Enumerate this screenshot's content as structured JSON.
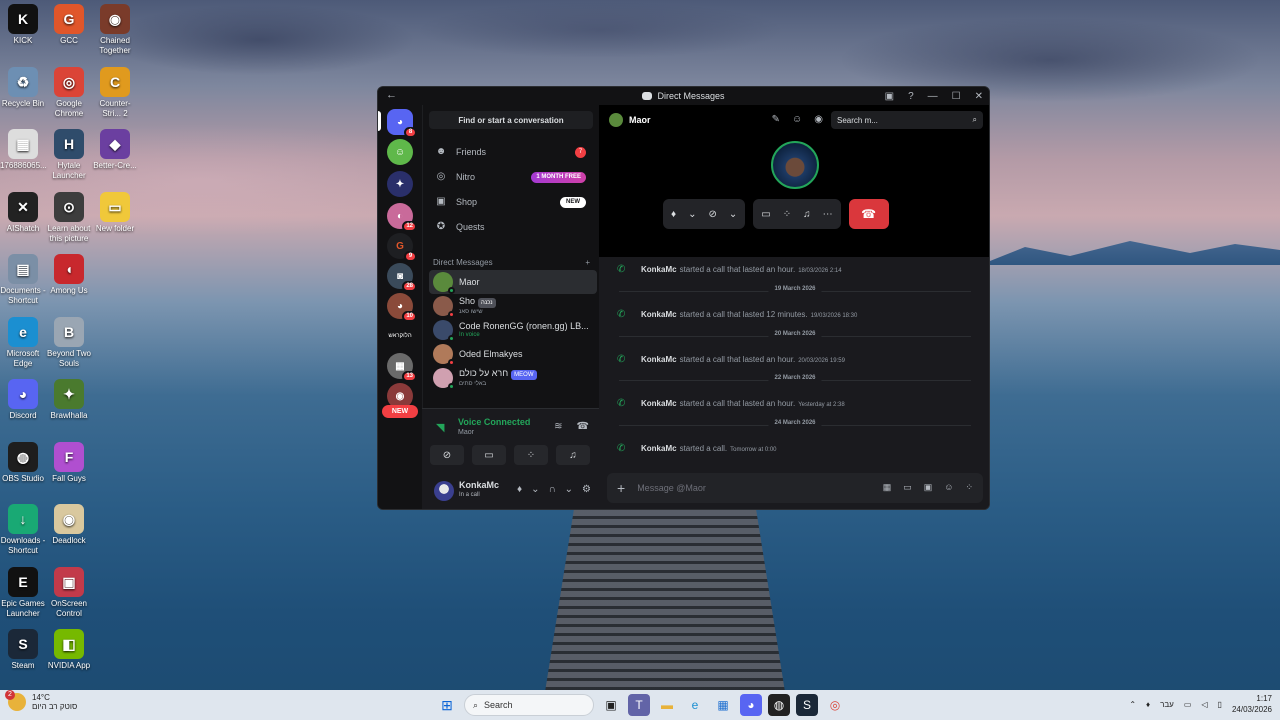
{
  "desktop": {
    "icons": [
      {
        "label": "KICK",
        "color": "#111111",
        "glyph": "K"
      },
      {
        "label": "GCC",
        "color": "#e0562a",
        "glyph": "G"
      },
      {
        "label": "Chained Together",
        "color": "#7a3b2a",
        "glyph": "◉"
      },
      {
        "label": "Recycle Bin",
        "color": "#6d8fb3",
        "glyph": "♻"
      },
      {
        "label": "Google Chrome",
        "color": "#db4437",
        "glyph": "◎"
      },
      {
        "label": "Counter-Stri... 2",
        "color": "#e09a1e",
        "glyph": "C"
      },
      {
        "label": "176886065...",
        "color": "#dddddd",
        "glyph": "▦"
      },
      {
        "label": "Hytale Launcher",
        "color": "#2f4c6b",
        "glyph": "H"
      },
      {
        "label": "Better-Cre...",
        "color": "#6b3fa0",
        "glyph": "◆"
      },
      {
        "label": "AIShatch",
        "color": "#222222",
        "glyph": "✕"
      },
      {
        "label": "Learn about this picture",
        "color": "#3d3d3d",
        "glyph": "⊙"
      },
      {
        "label": "New folder",
        "color": "#f0c83a",
        "glyph": "▭"
      },
      {
        "label": "Documents - Shortcut",
        "color": "#7b8fa6",
        "glyph": "▤"
      },
      {
        "label": "Among Us",
        "color": "#c8282d",
        "glyph": "◖"
      },
      {
        "label": "Microsoft Edge",
        "color": "#1b8fd1",
        "glyph": "e"
      },
      {
        "label": "Beyond Two Souls",
        "color": "#9aa6b3",
        "glyph": "B"
      },
      {
        "label": "Discord",
        "color": "#5865f2",
        "glyph": "◕"
      },
      {
        "label": "Brawlhalla",
        "color": "#4a7a2e",
        "glyph": "✦"
      },
      {
        "label": "OBS Studio",
        "color": "#1e1e1e",
        "glyph": "◍"
      },
      {
        "label": "Fall Guys",
        "color": "#b04fd0",
        "glyph": "F"
      },
      {
        "label": "Downloads - Shortcut",
        "color": "#19a974",
        "glyph": "↓"
      },
      {
        "label": "Deadlock",
        "color": "#d9c89e",
        "glyph": "◉"
      },
      {
        "label": "Epic Games Launcher",
        "color": "#111111",
        "glyph": "E"
      },
      {
        "label": "OnScreen Control",
        "color": "#c23a4a",
        "glyph": "▣"
      },
      {
        "label": "Steam",
        "color": "#1b2838",
        "glyph": "S"
      },
      {
        "label": "NVIDIA App",
        "color": "#76b900",
        "glyph": "◧"
      }
    ]
  },
  "taskbar": {
    "weather_temp": "14°C",
    "weather_desc": "סוטק רב היום",
    "weather_badge": "2",
    "search_label": "Search",
    "lang": "עבר",
    "time": "1:17",
    "date": "24/03/2026"
  },
  "window": {
    "title": "Direct Messages",
    "back": "←",
    "help": "?",
    "minimize": "—",
    "maximize": "☐",
    "close": "✕"
  },
  "servers": {
    "badges": [
      "8",
      "",
      "",
      "12",
      "9",
      "28",
      "10",
      "",
      "13"
    ],
    "new_label": "NEW",
    "text_server": "הלוקראש"
  },
  "dm_nav": {
    "find_label": "Find or start a conversation",
    "items": [
      {
        "label": "Friends",
        "icon": "friends-icon",
        "glyph": "☻"
      },
      {
        "label": "Nitro",
        "icon": "nitro-icon",
        "glyph": "◎"
      },
      {
        "label": "Shop",
        "icon": "shop-icon",
        "glyph": "▣"
      },
      {
        "label": "Quests",
        "icon": "quests-icon",
        "glyph": "✪"
      }
    ],
    "friends_count": "7",
    "nitro_badge": "1 MONTH FREE",
    "shop_badge": "NEW",
    "dm_header": "Direct Messages",
    "add": "+"
  },
  "dms": [
    {
      "name": "Maor",
      "sub": "",
      "color": "#5a8a3c",
      "status": "#23a55a",
      "active": true
    },
    {
      "name": "Sho",
      "tag": "נכנה",
      "sub": "שישו סאנ",
      "color": "#8a5a4a",
      "status": "#f23f43",
      "active": false
    },
    {
      "name": "Code RonenGG (ronen.gg) LB...",
      "sub": "In voice",
      "color": "#3a4a6a",
      "status": "#23a55a",
      "active": false
    },
    {
      "name": "Oded Elmakyes",
      "sub": "",
      "color": "#b07a5a",
      "status": "#f23f43",
      "active": false
    },
    {
      "name": "חרא על כולם",
      "tag": "MEOW",
      "sub": "באלי סתים",
      "color": "#d0a0b0",
      "status": "#23a55a",
      "active": false
    }
  ],
  "voice": {
    "title": "Voice Connected",
    "channel": "Maor"
  },
  "user": {
    "name": "KonkaMc",
    "status": "In a call"
  },
  "chat": {
    "recipient": "Maor",
    "search_placeholder": "Search m...",
    "composer_placeholder": "Message @Maor",
    "messages": [
      {
        "author": "KonkaMc",
        "text": "started a call that lasted an hour.",
        "time": "18/03/2026 2:14"
      },
      {
        "author": "KonkaMc",
        "text": "started a call that lasted 12 minutes.",
        "time": "19/03/2026 18:30"
      },
      {
        "author": "KonkaMc",
        "text": "started a call that lasted an hour.",
        "time": "20/03/2026 19:59"
      },
      {
        "author": "KonkaMc",
        "text": "started a call that lasted an hour.",
        "time": "Yesterday at 2:38"
      },
      {
        "author": "KonkaMc",
        "text": "started a call.",
        "time": "Tomorrow at 0:00"
      }
    ],
    "dividers": [
      "19 March 2026",
      "20 March 2026",
      "22 March 2026",
      "24 March 2026"
    ]
  }
}
